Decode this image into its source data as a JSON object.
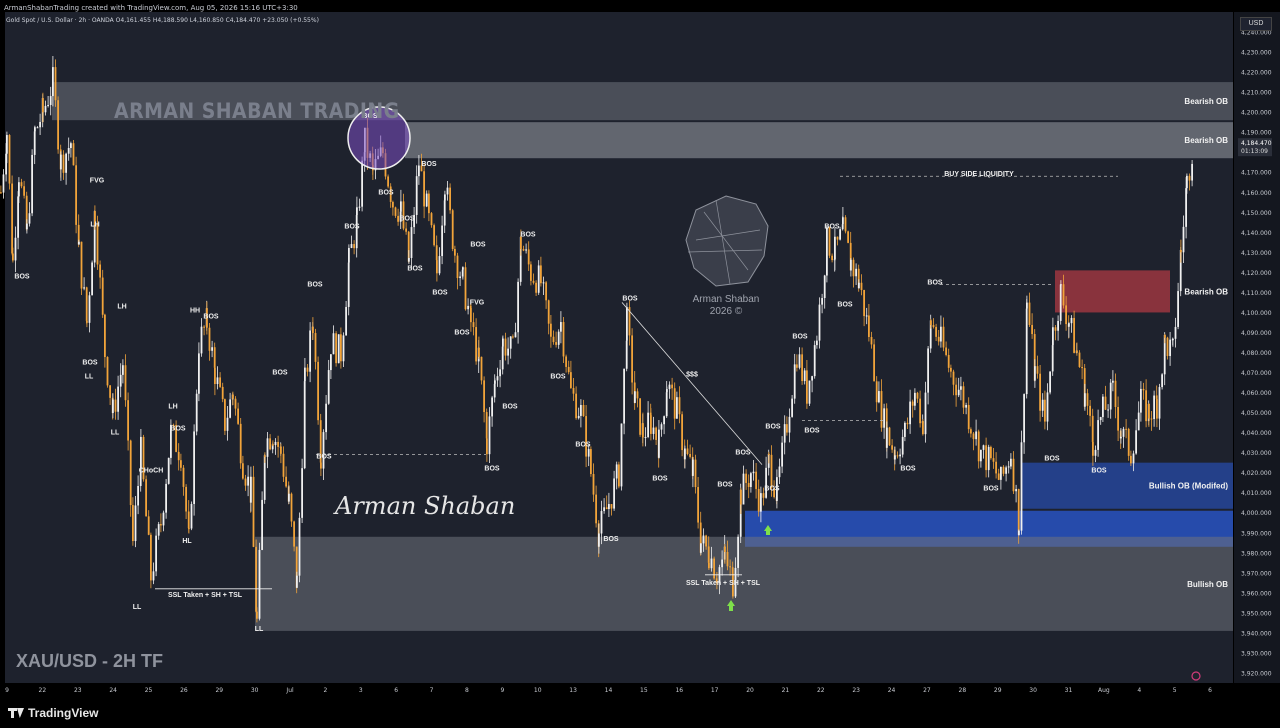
{
  "header": {
    "credit": "ArmanShabanTrading created with TradingView.com, Aug 05, 2026 15:16 UTC+3:30",
    "symbol_line": "Gold Spot / U.S. Dollar · 2h · OANDA  O4,161.455 H4,188.590 L4,160.850 C4,184.470 +23.050 (+0.55%)"
  },
  "currency": "USD",
  "brand": "ARMAN SHABAN TRADING",
  "timeframe_label": "XAU/USD - 2H TF",
  "signature": "Arman Shaban",
  "watermark_line1": "Arman Shaban",
  "watermark_line2": "2026 ©",
  "footer_logo": "TradingView",
  "colors": {
    "background": "#1e222d",
    "bull": "#f0f0f0",
    "bear": "#f2a43a",
    "bearish_ob": "#b73a45",
    "bullish_ob": "#2a5ad6",
    "zone_grey": "#6f727b"
  },
  "chart_data": {
    "type": "candlestick",
    "symbol": "XAU/USD",
    "ylim": [
      3915,
      4250
    ],
    "yticks": [
      3920,
      3930,
      3940,
      3950,
      3960,
      3970,
      3980,
      3990,
      4000,
      4010,
      4020,
      4030,
      4040,
      4050,
      4060,
      4070,
      4080,
      4090,
      4100,
      4110,
      4120,
      4130,
      4140,
      4150,
      4160,
      4170,
      4180,
      4190,
      4200,
      4210,
      4220,
      4230,
      4240
    ],
    "xticks": [
      "9",
      "22",
      "23",
      "24",
      "25",
      "26",
      "29",
      "30",
      "Jul",
      "2",
      "3",
      "6",
      "7",
      "8",
      "9",
      "10",
      "13",
      "14",
      "15",
      "16",
      "17",
      "20",
      "21",
      "22",
      "23",
      "24",
      "27",
      "28",
      "29",
      "30",
      "31",
      "Aug",
      "4",
      "5",
      "6"
    ],
    "last_price": "4,184.470",
    "countdown": "01:13:09",
    "path": [
      [
        0,
        4160
      ],
      [
        6,
        4190
      ],
      [
        12,
        4125
      ],
      [
        18,
        4170
      ],
      [
        26,
        4140
      ],
      [
        34,
        4190
      ],
      [
        42,
        4200
      ],
      [
        52,
        4215
      ],
      [
        60,
        4175
      ],
      [
        70,
        4185
      ],
      [
        78,
        4130
      ],
      [
        86,
        4095
      ],
      [
        94,
        4150
      ],
      [
        104,
        4080
      ],
      [
        112,
        4050
      ],
      [
        122,
        4075
      ],
      [
        132,
        3985
      ],
      [
        140,
        4030
      ],
      [
        150,
        3968
      ],
      [
        160,
        3995
      ],
      [
        170,
        4040
      ],
      [
        180,
        4030
      ],
      [
        188,
        3985
      ],
      [
        198,
        4085
      ],
      [
        206,
        4095
      ],
      [
        214,
        4070
      ],
      [
        224,
        4045
      ],
      [
        232,
        4060
      ],
      [
        242,
        4025
      ],
      [
        250,
        4010
      ],
      [
        256,
        3945
      ],
      [
        264,
        4035
      ],
      [
        272,
        4040
      ],
      [
        280,
        4030
      ],
      [
        288,
        4005
      ],
      [
        296,
        3965
      ],
      [
        304,
        4065
      ],
      [
        312,
        4095
      ],
      [
        320,
        4030
      ],
      [
        330,
        4085
      ],
      [
        340,
        4080
      ],
      [
        348,
        4125
      ],
      [
        356,
        4145
      ],
      [
        364,
        4185
      ],
      [
        372,
        4170
      ],
      [
        382,
        4180
      ],
      [
        392,
        4155
      ],
      [
        400,
        4150
      ],
      [
        408,
        4125
      ],
      [
        418,
        4175
      ],
      [
        428,
        4145
      ],
      [
        436,
        4120
      ],
      [
        444,
        4165
      ],
      [
        454,
        4130
      ],
      [
        462,
        4115
      ],
      [
        470,
        4095
      ],
      [
        478,
        4075
      ],
      [
        486,
        4035
      ],
      [
        494,
        4065
      ],
      [
        502,
        4085
      ],
      [
        512,
        4080
      ],
      [
        520,
        4135
      ],
      [
        530,
        4120
      ],
      [
        540,
        4115
      ],
      [
        550,
        4085
      ],
      [
        560,
        4095
      ],
      [
        570,
        4060
      ],
      [
        580,
        4050
      ],
      [
        590,
        4020
      ],
      [
        598,
        3990
      ],
      [
        608,
        4005
      ],
      [
        618,
        4020
      ],
      [
        626,
        4095
      ],
      [
        634,
        4055
      ],
      [
        642,
        4040
      ],
      [
        650,
        4045
      ],
      [
        658,
        4035
      ],
      [
        666,
        4065
      ],
      [
        676,
        4050
      ],
      [
        684,
        4030
      ],
      [
        692,
        4020
      ],
      [
        700,
        3985
      ],
      [
        708,
        3980
      ],
      [
        716,
        3970
      ],
      [
        724,
        3978
      ],
      [
        732,
        3965
      ],
      [
        740,
        4010
      ],
      [
        750,
        4020
      ],
      [
        760,
        4005
      ],
      [
        768,
        4025
      ],
      [
        776,
        4010
      ],
      [
        786,
        4045
      ],
      [
        796,
        4080
      ],
      [
        806,
        4060
      ],
      [
        816,
        4090
      ],
      [
        826,
        4135
      ],
      [
        834,
        4130
      ],
      [
        842,
        4140
      ],
      [
        850,
        4125
      ],
      [
        858,
        4115
      ],
      [
        868,
        4090
      ],
      [
        878,
        4055
      ],
      [
        886,
        4040
      ],
      [
        894,
        4030
      ],
      [
        904,
        4040
      ],
      [
        914,
        4060
      ],
      [
        922,
        4045
      ],
      [
        930,
        4095
      ],
      [
        940,
        4085
      ],
      [
        950,
        4070
      ],
      [
        960,
        4060
      ],
      [
        970,
        4045
      ],
      [
        980,
        4030
      ],
      [
        990,
        4025
      ],
      [
        1000,
        4015
      ],
      [
        1010,
        4030
      ],
      [
        1018,
        3995
      ],
      [
        1026,
        4105
      ],
      [
        1034,
        4070
      ],
      [
        1044,
        4045
      ],
      [
        1052,
        4090
      ],
      [
        1060,
        4110
      ],
      [
        1068,
        4095
      ],
      [
        1076,
        4080
      ],
      [
        1084,
        4060
      ],
      [
        1092,
        4035
      ],
      [
        1102,
        4050
      ],
      [
        1112,
        4060
      ],
      [
        1120,
        4040
      ],
      [
        1130,
        4030
      ],
      [
        1140,
        4055
      ],
      [
        1148,
        4050
      ],
      [
        1156,
        4055
      ],
      [
        1164,
        4085
      ],
      [
        1172,
        4080
      ],
      [
        1180,
        4130
      ],
      [
        1186,
        4165
      ],
      [
        1192,
        4184
      ]
    ]
  },
  "zones": [
    {
      "label": "Bearish OB",
      "top": 4215,
      "bottom": 4196
    },
    {
      "label": "Bearish OB",
      "top": 4195,
      "bottom": 4177
    },
    {
      "label": "Bearish OB",
      "top": 4121,
      "bottom": 4100
    },
    {
      "label": "Bullish OB (Modifed)",
      "top": 4025,
      "bottom": 4002
    },
    {
      "label": "",
      "top": 4001,
      "bottom": 3983
    },
    {
      "label": "Bullish OB",
      "top": 3988,
      "bottom": 3941
    }
  ],
  "labels": [
    {
      "text": "BOS",
      "x": 22,
      "v": 4117
    },
    {
      "text": "FVG",
      "x": 97,
      "v": 4165
    },
    {
      "text": "LH",
      "x": 95,
      "v": 4143
    },
    {
      "text": "BOS",
      "x": 90,
      "v": 4074
    },
    {
      "text": "LL",
      "x": 89,
      "v": 4067
    },
    {
      "text": "LH",
      "x": 122,
      "v": 4102
    },
    {
      "text": "LH",
      "x": 173,
      "v": 4052
    },
    {
      "text": "LL",
      "x": 115,
      "v": 4039
    },
    {
      "text": "HH",
      "x": 195,
      "v": 4100
    },
    {
      "text": "BOS",
      "x": 211,
      "v": 4097
    },
    {
      "text": "BOS",
      "x": 178,
      "v": 4041
    },
    {
      "text": "CHoCH",
      "x": 151,
      "v": 4020
    },
    {
      "text": "HL",
      "x": 187,
      "v": 3985
    },
    {
      "text": "LL",
      "x": 137,
      "v": 3952
    },
    {
      "text": "SSL Taken + SH + TSL",
      "x": 205,
      "v": 3958
    },
    {
      "text": "LL",
      "x": 259,
      "v": 3941
    },
    {
      "text": "BOS",
      "x": 280,
      "v": 4069
    },
    {
      "text": "BOS",
      "x": 324,
      "v": 4027
    },
    {
      "text": "BOS",
      "x": 315,
      "v": 4113
    },
    {
      "text": "BOS",
      "x": 352,
      "v": 4142
    },
    {
      "text": "BOS",
      "x": 370,
      "v": 4197
    },
    {
      "text": "BOS",
      "x": 386,
      "v": 4159
    },
    {
      "text": "BOS",
      "x": 407,
      "v": 4146
    },
    {
      "text": "BOS",
      "x": 429,
      "v": 4173
    },
    {
      "text": "BOS",
      "x": 415,
      "v": 4121
    },
    {
      "text": "BOS",
      "x": 440,
      "v": 4109
    },
    {
      "text": "BOS",
      "x": 462,
      "v": 4089
    },
    {
      "text": "FVG",
      "x": 477,
      "v": 4104
    },
    {
      "text": "BOS",
      "x": 478,
      "v": 4133
    },
    {
      "text": "BOS",
      "x": 510,
      "v": 4052
    },
    {
      "text": "BOS",
      "x": 492,
      "v": 4021
    },
    {
      "text": "BOS",
      "x": 528,
      "v": 4138
    },
    {
      "text": "BOS",
      "x": 558,
      "v": 4067
    },
    {
      "text": "BOS",
      "x": 583,
      "v": 4033
    },
    {
      "text": "BOS",
      "x": 630,
      "v": 4106
    },
    {
      "text": "$$$",
      "x": 692,
      "v": 4068
    },
    {
      "text": "BOS",
      "x": 660,
      "v": 4016
    },
    {
      "text": "BOS",
      "x": 611,
      "v": 3986
    },
    {
      "text": "BOS",
      "x": 725,
      "v": 4013
    },
    {
      "text": "BOS",
      "x": 743,
      "v": 4029
    },
    {
      "text": "BOS",
      "x": 773,
      "v": 4042
    },
    {
      "text": "BOS",
      "x": 772,
      "v": 4011
    },
    {
      "text": "SSL Taken + SH + TSL",
      "x": 723,
      "v": 3964
    },
    {
      "text": "BOS",
      "x": 800,
      "v": 4087
    },
    {
      "text": "BOS",
      "x": 812,
      "v": 4040
    },
    {
      "text": "BOS",
      "x": 832,
      "v": 4142
    },
    {
      "text": "BOS",
      "x": 845,
      "v": 4103
    },
    {
      "text": "BUY SIDE LIQUIDITY",
      "x": 979,
      "v": 4168
    },
    {
      "text": "BOS",
      "x": 935,
      "v": 4114
    },
    {
      "text": "BOS",
      "x": 908,
      "v": 4021
    },
    {
      "text": "BOS",
      "x": 991,
      "v": 4011
    },
    {
      "text": "BOS",
      "x": 1052,
      "v": 4026
    },
    {
      "text": "BOS",
      "x": 1099,
      "v": 4020
    }
  ]
}
